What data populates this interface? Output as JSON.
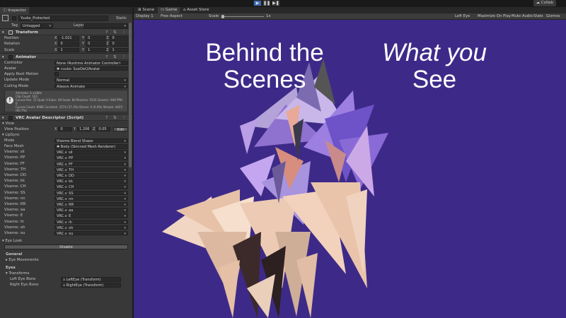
{
  "toolbar": {
    "play": "▶",
    "pause": "❚❚",
    "step": "▶❚",
    "collab": "Collab"
  },
  "inspector": {
    "tab": "Inspector",
    "object_name": "Yuuko_Protected",
    "static_label": "Static",
    "tag_label": "Tag",
    "tag_value": "Untagged",
    "layer_label": "Layer",
    "layer_value": ""
  },
  "transform": {
    "title": "Transform",
    "rows": [
      {
        "label": "Position",
        "x": "-1.021",
        "y": "0",
        "z": "0"
      },
      {
        "label": "Rotation",
        "x": "0",
        "y": "0",
        "z": "0"
      },
      {
        "label": "Scale",
        "x": "1",
        "y": "1",
        "z": "1"
      }
    ]
  },
  "animator": {
    "title": "Animator",
    "rows": [
      {
        "label": "Controller",
        "value": "None (Runtime Animator Controller)"
      },
      {
        "label": "Avatar",
        "value": "✱ yuuko_SupOpt2Avatar"
      },
      {
        "label": "Apply Root Motion",
        "value": ""
      },
      {
        "label": "Update Mode",
        "value": "Normal"
      },
      {
        "label": "Culling Mode",
        "value": "Always Animate"
      }
    ],
    "info": [
      "Animator is visible",
      "Clip Count: 103",
      "Curves Pos: 72 Quat: 0 Euler: 49 Scale: 84 Muscles: 5531 Generic: 946 PPtr: 0",
      "Curves Count: 6686 Constant: 2574 (37.3%) Dense: 0 (0.0%) Stream: 4025",
      "(60.7%)"
    ]
  },
  "descriptor": {
    "title": "VRC Avatar Descriptor (Script)",
    "view_section": "View",
    "view_position_label": "View Position",
    "view_x": "0",
    "view_y": "1.206",
    "view_z": "0.05",
    "edit_label": "Edit",
    "lipsync_section": "LipSync",
    "mode_label": "Mode",
    "mode_value": "Viseme Blend Shape",
    "face_mesh_label": "Face Mesh",
    "face_mesh_value": "✱ Body (Skinned Mesh Renderer)",
    "visemes": [
      {
        "label": "Viseme: sil",
        "value": "VRC.v_sil"
      },
      {
        "label": "Viseme: PP",
        "value": "VRC.v_PP"
      },
      {
        "label": "Viseme: FF",
        "value": "VRC.v_FF"
      },
      {
        "label": "Viseme: TH",
        "value": "VRC.v_TH"
      },
      {
        "label": "Viseme: DD",
        "value": "VRC.v_DD"
      },
      {
        "label": "Viseme: kk",
        "value": "VRC.v_kk"
      },
      {
        "label": "Viseme: CH",
        "value": "VRC.v_CH"
      },
      {
        "label": "Viseme: SS",
        "value": "VRC.v_SS"
      },
      {
        "label": "Viseme: nn",
        "value": "VRC.v_nn"
      },
      {
        "label": "Viseme: RR",
        "value": "VRC.v_RR"
      },
      {
        "label": "Viseme: aa",
        "value": "VRC.v_aa"
      },
      {
        "label": "Viseme: E",
        "value": "VRC.v_E"
      },
      {
        "label": "Viseme: ih",
        "value": "VRC.v_ih"
      },
      {
        "label": "Viseme: oh",
        "value": "VRC.v_oh"
      },
      {
        "label": "Viseme: ou",
        "value": "VRC.v_ou"
      }
    ],
    "eyelook_section": "Eye Look",
    "disable_label": "Disable",
    "general_label": "General",
    "eye_movements_label": "Eye Movements",
    "eyes_label": "Eyes",
    "transforms_label": "Transforms",
    "left_eye_label": "Left Eye Bone",
    "left_eye_value": "⅄ LeftEye (Transform)",
    "right_eye_label": "Right Eye Bone",
    "right_eye_value": "⅄ RightEye (Transform)"
  },
  "game": {
    "tabs": [
      "Scene",
      "Game",
      "Asset Store"
    ],
    "display": "Display 1",
    "aspect": "Free Aspect",
    "scale_label": "Scale",
    "scale_value": "1x",
    "left_eye": "Left Eye",
    "maximize": "Maximize On Play",
    "mute": "Mute Audio",
    "stats": "Stats",
    "gizmos": "Gizmos",
    "caption_left_line1": "Behind the",
    "caption_left_line2": "Scenes",
    "caption_right_line1a": "What ",
    "caption_right_line1b": "you",
    "caption_right_line2": "See",
    "background_color": "#3d2a88"
  }
}
